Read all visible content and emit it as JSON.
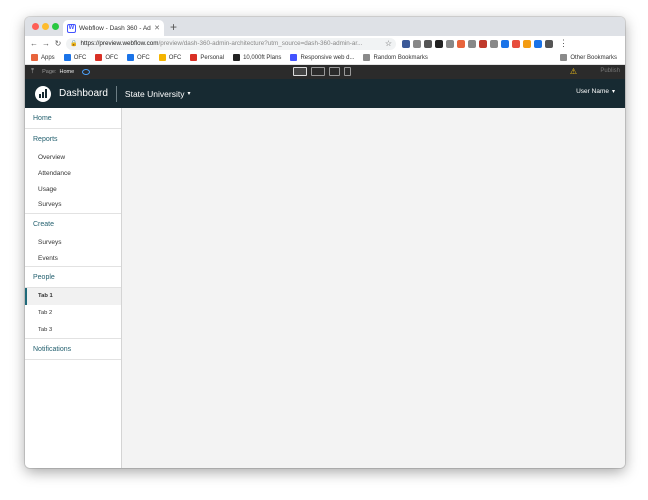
{
  "browser": {
    "tab_title": "Webflow - Dash 360 - Admin A",
    "tab_favicon": "W",
    "url_host": "https://preview.webflow.com",
    "url_path": "/preview/dash-360-admin-architecture?utm_source=dash-360-admin-ar...",
    "bookmarks": [
      {
        "label": "Apps",
        "color": "#e8643c"
      },
      {
        "label": "OFC",
        "color": "#1a73e8"
      },
      {
        "label": "OFC",
        "color": "#d93025"
      },
      {
        "label": "OFC",
        "color": "#1a73e8"
      },
      {
        "label": "OFC",
        "color": "#f4b400"
      },
      {
        "label": "Personal",
        "color": "#d93025"
      },
      {
        "label": "10,000ft Plans",
        "color": "#222222"
      },
      {
        "label": "Responsive web d...",
        "color": "#4353ff"
      },
      {
        "label": "Random Bookmarks",
        "color": "#8a8a8a"
      }
    ],
    "other_bookmarks": "Other Bookmarks",
    "extension_colors": [
      "#3b5998",
      "#888888",
      "#555555",
      "#222222",
      "#888888",
      "#e8643c",
      "#888888",
      "#c0392b",
      "#888888",
      "#1a73e8",
      "#e74c3c",
      "#f39c12",
      "#1a73e8",
      "#555555"
    ]
  },
  "webflow_bar": {
    "page_label": "Page:",
    "page_name": "Home",
    "publish_label": "Publish"
  },
  "header": {
    "app_title": "Dashboard",
    "org_name": "State University",
    "user_name": "User Name"
  },
  "sidebar": {
    "home": "Home",
    "reports": {
      "label": "Reports",
      "items": [
        "Overview",
        "Attendance",
        "Usage",
        "Surveys"
      ]
    },
    "create": {
      "label": "Create",
      "items": [
        "Surveys",
        "Events"
      ]
    },
    "people": {
      "label": "People",
      "tabs": [
        "Tab 1",
        "Tab 2",
        "Tab 3"
      ],
      "active_tab": "Tab 1"
    },
    "notifications": "Notifications"
  }
}
